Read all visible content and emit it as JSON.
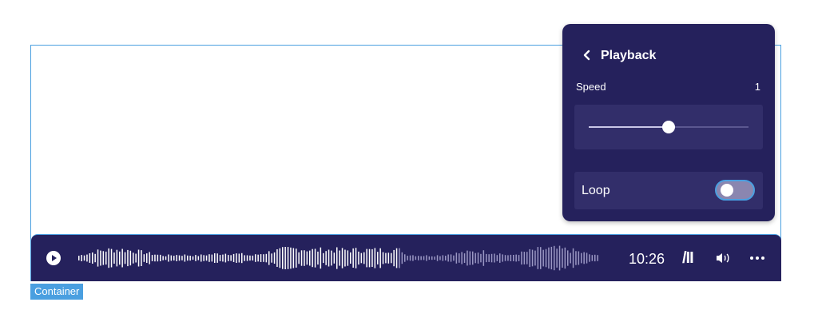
{
  "container": {
    "label": "Container"
  },
  "panel": {
    "title": "Playback",
    "speed": {
      "label": "Speed",
      "value": "1",
      "slider_fraction": 0.5
    },
    "loop": {
      "label": "Loop",
      "enabled": false
    }
  },
  "player": {
    "time": "10:26",
    "played_fraction": 0.61,
    "icons": [
      "play-icon",
      "slash-icon",
      "volume-icon",
      "more-icon"
    ],
    "slash_glyph": "/II"
  },
  "colors": {
    "player_bg": "#25215c",
    "panel_row_bg": "#322e6a",
    "accent_blue": "#4a9fe0",
    "wave_played": "#ffffff",
    "wave_unplayed": "#9b98c4"
  }
}
